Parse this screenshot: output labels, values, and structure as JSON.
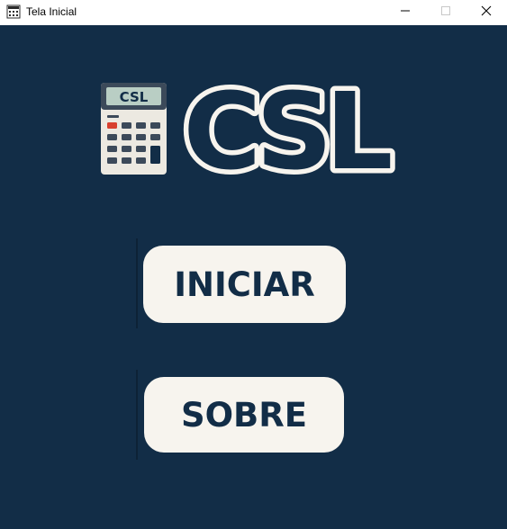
{
  "window": {
    "title": "Tela Inicial",
    "app_icon": "calculator-icon",
    "controls": [
      "minimize-icon",
      "maximize-icon",
      "close-icon"
    ]
  },
  "logo": {
    "calculator_display_text": "CSL",
    "wordmark": "CSL"
  },
  "buttons": {
    "start_label": "INICIAR",
    "about_label": "SOBRE"
  },
  "colors": {
    "background": "#122d47",
    "button_fill": "#f7f4ee",
    "button_text": "#122d47",
    "calculator_red_key": "#d8402f"
  }
}
